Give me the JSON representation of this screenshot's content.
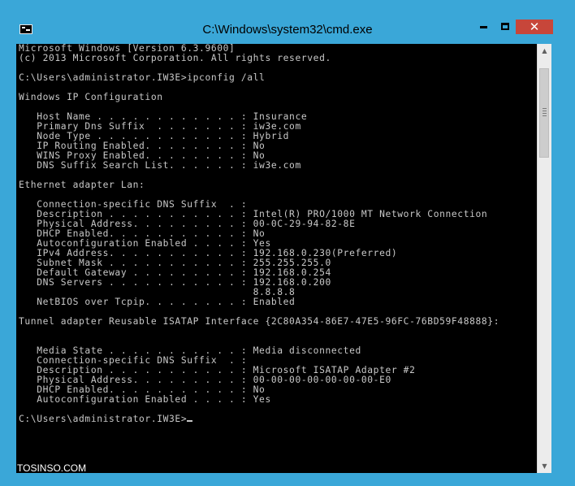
{
  "window": {
    "title": "C:\\Windows\\system32\\cmd.exe",
    "app_icon": "cmd-icon",
    "controls": {
      "minimize": "minimize-icon",
      "maximize": "maximize-icon",
      "close_glyph": "✕"
    }
  },
  "console": {
    "lines": [
      "Microsoft Windows [Version 6.3.9600]",
      "(c) 2013 Microsoft Corporation. All rights reserved.",
      "",
      "C:\\Users\\administrator.IW3E>ipconfig /all",
      "",
      "Windows IP Configuration",
      "",
      "   Host Name . . . . . . . . . . . . : Insurance",
      "   Primary Dns Suffix  . . . . . . . : iw3e.com",
      "   Node Type . . . . . . . . . . . . : Hybrid",
      "   IP Routing Enabled. . . . . . . . : No",
      "   WINS Proxy Enabled. . . . . . . . : No",
      "   DNS Suffix Search List. . . . . . : iw3e.com",
      "",
      "Ethernet adapter Lan:",
      "",
      "   Connection-specific DNS Suffix  . :",
      "   Description . . . . . . . . . . . : Intel(R) PRO/1000 MT Network Connection",
      "   Physical Address. . . . . . . . . : 00-0C-29-94-82-8E",
      "   DHCP Enabled. . . . . . . . . . . : No",
      "   Autoconfiguration Enabled . . . . : Yes",
      "   IPv4 Address. . . . . . . . . . . : 192.168.0.230(Preferred)",
      "   Subnet Mask . . . . . . . . . . . : 255.255.255.0",
      "   Default Gateway . . . . . . . . . : 192.168.0.254",
      "   DNS Servers . . . . . . . . . . . : 192.168.0.200",
      "                                       8.8.8.8",
      "   NetBIOS over Tcpip. . . . . . . . : Enabled",
      "",
      "Tunnel adapter Reusable ISATAP Interface {2C80A354-86E7-47E5-96FC-76BD59F48888}:",
      "",
      "",
      "   Media State . . . . . . . . . . . : Media disconnected",
      "   Connection-specific DNS Suffix  . :",
      "   Description . . . . . . . . . . . : Microsoft ISATAP Adapter #2",
      "   Physical Address. . . . . . . . . : 00-00-00-00-00-00-00-E0",
      "   DHCP Enabled. . . . . . . . . . . : No",
      "   Autoconfiguration Enabled . . . . : Yes",
      ""
    ],
    "prompt": "C:\\Users\\administrator.IW3E>"
  },
  "scrollbar": {
    "up_glyph": "▲",
    "down_glyph": "▼"
  },
  "watermark": "TOSINSO.COM",
  "colors": {
    "frame": "#3aa7d8",
    "close": "#c7463a",
    "console_bg": "#000000",
    "console_fg": "#c8c8c8"
  }
}
